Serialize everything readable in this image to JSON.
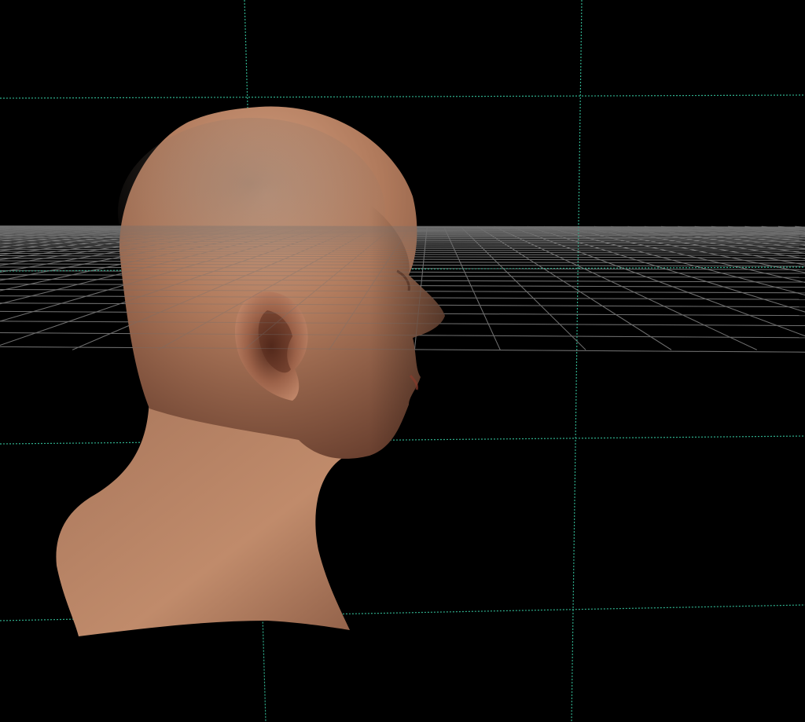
{
  "viewport": {
    "background": "#000000",
    "grid_color": "#6f6f6f",
    "guide_color": "#2fae8c",
    "skin_base": "#b07a5c",
    "skin_highlight": "#d6a283",
    "skin_shadow": "#5a3526",
    "scalp_stubble": "#7d6a5e"
  },
  "scene": {
    "object": "head-model",
    "view": "perspective"
  }
}
